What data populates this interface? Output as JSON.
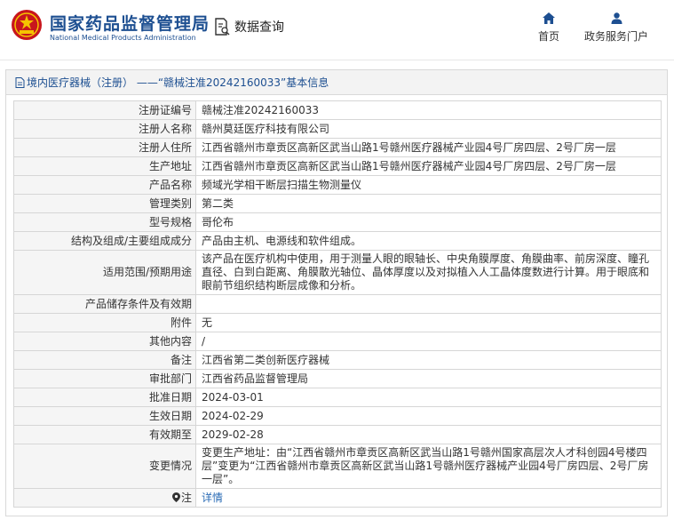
{
  "header": {
    "brand_cn": "国家药品监督管理局",
    "brand_en": "National Medical Products Administration",
    "query_label": "数据查询",
    "nav": [
      {
        "label": "首页",
        "icon": "home-icon"
      },
      {
        "label": "政务服务门户",
        "icon": "user-icon"
      }
    ]
  },
  "title": "境内医疗器械（注册） ——“赣械注准20242160033”基本信息",
  "colors": {
    "brand": "#1d4f91",
    "link": "#2a6bb5",
    "label_bg": "#f5f5f5",
    "border": "#d6d6d6"
  },
  "rows": [
    {
      "label": "注册证编号",
      "value": "赣械注准20242160033"
    },
    {
      "label": "注册人名称",
      "value": "赣州莫廷医疗科技有限公司"
    },
    {
      "label": "注册人住所",
      "value": "江西省赣州市章贡区高新区武当山路1号赣州医疗器械产业园4号厂房四层、2号厂房一层"
    },
    {
      "label": "生产地址",
      "value": "江西省赣州市章贡区高新区武当山路1号赣州医疗器械产业园4号厂房四层、2号厂房一层"
    },
    {
      "label": "产品名称",
      "value": "频域光学相干断层扫描生物测量仪"
    },
    {
      "label": "管理类别",
      "value": "第二类"
    },
    {
      "label": "型号规格",
      "value": "哥伦布"
    },
    {
      "label": "结构及组成/主要组成成分",
      "value": "产品由主机、电源线和软件组成。"
    },
    {
      "label": "适用范围/预期用途",
      "value": "该产品在医疗机构中使用，用于测量人眼的眼轴长、中央角膜厚度、角膜曲率、前房深度、瞳孔直径、白到白距离、角膜散光轴位、晶体厚度以及对拟植入人工晶体度数进行计算。用于眼底和眼前节组织结构断层成像和分析。"
    },
    {
      "label": "产品储存条件及有效期",
      "value": ""
    },
    {
      "label": "附件",
      "value": "无"
    },
    {
      "label": "其他内容",
      "value": "/"
    },
    {
      "label": "备注",
      "value": "江西省第二类创新医疗器械"
    },
    {
      "label": "审批部门",
      "value": "江西省药品监督管理局"
    },
    {
      "label": "批准日期",
      "value": "2024-03-01"
    },
    {
      "label": "生效日期",
      "value": "2024-02-29"
    },
    {
      "label": "有效期至",
      "value": "2029-02-28"
    },
    {
      "label": "变更情况",
      "value": "变更生产地址：由“江西省赣州市章贡区高新区武当山路1号赣州国家高层次人才科创园4号楼四层”变更为“江西省赣州市章贡区高新区武当山路1号赣州医疗器械产业园4号厂房四层、2号厂房一层”。"
    },
    {
      "label": "注",
      "value": "详情",
      "icon": "location-pin-icon"
    }
  ]
}
